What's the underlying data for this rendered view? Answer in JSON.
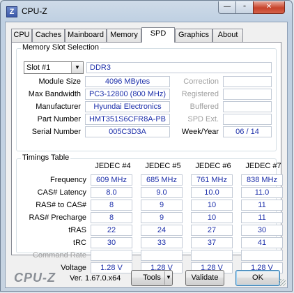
{
  "window": {
    "title": "CPU-Z",
    "icon_letter": "Z",
    "minimize_icon": "minimize-icon",
    "maximize_icon": "maximize-icon",
    "close_icon": "close-icon",
    "min_glyph": "—",
    "max_glyph": "▫",
    "close_glyph": "✕"
  },
  "tabs": [
    "CPU",
    "Caches",
    "Mainboard",
    "Memory",
    "SPD",
    "Graphics",
    "About"
  ],
  "active_tab": "SPD",
  "memory_slot": {
    "group_title": "Memory Slot Selection",
    "slot_selected": "Slot #1",
    "memory_type": "DDR3",
    "module_size_label": "Module Size",
    "module_size": "4096 MBytes",
    "max_bandwidth_label": "Max Bandwidth",
    "max_bandwidth": "PC3-12800 (800 MHz)",
    "manufacturer_label": "Manufacturer",
    "manufacturer": "Hyundai Electronics",
    "part_number_label": "Part Number",
    "part_number": "HMT351S6CFR8A-PB",
    "serial_number_label": "Serial Number",
    "serial_number": "005C3D3A",
    "correction_label": "Correction",
    "correction": "",
    "registered_label": "Registered",
    "registered": "",
    "buffered_label": "Buffered",
    "buffered": "",
    "spd_ext_label": "SPD Ext.",
    "spd_ext": "",
    "week_year_label": "Week/Year",
    "week_year": "06 / 14"
  },
  "timings": {
    "group_title": "Timings Table",
    "columns": [
      "JEDEC #4",
      "JEDEC #5",
      "JEDEC #6",
      "JEDEC #7"
    ],
    "rows": [
      {
        "label": "Frequency",
        "disabled": false,
        "values": [
          "609 MHz",
          "685 MHz",
          "761 MHz",
          "838 MHz"
        ]
      },
      {
        "label": "CAS# Latency",
        "disabled": false,
        "values": [
          "8.0",
          "9.0",
          "10.0",
          "11.0"
        ]
      },
      {
        "label": "RAS# to CAS#",
        "disabled": false,
        "values": [
          "8",
          "9",
          "10",
          "11"
        ]
      },
      {
        "label": "RAS# Precharge",
        "disabled": false,
        "values": [
          "8",
          "9",
          "10",
          "11"
        ]
      },
      {
        "label": "tRAS",
        "disabled": false,
        "values": [
          "22",
          "24",
          "27",
          "30"
        ]
      },
      {
        "label": "tRC",
        "disabled": false,
        "values": [
          "30",
          "33",
          "37",
          "41"
        ]
      },
      {
        "label": "Command Rate",
        "disabled": true,
        "values": [
          "",
          "",
          "",
          ""
        ]
      },
      {
        "label": "Voltage",
        "disabled": false,
        "values": [
          "1.28 V",
          "1.28 V",
          "1.28 V",
          "1.28 V"
        ]
      }
    ]
  },
  "footer": {
    "logo": "CPU-Z",
    "version": "Ver. 1.67.0.x64",
    "tools_label": "Tools",
    "tools_arrow": "▼",
    "validate_label": "Validate",
    "ok_label": "OK"
  }
}
